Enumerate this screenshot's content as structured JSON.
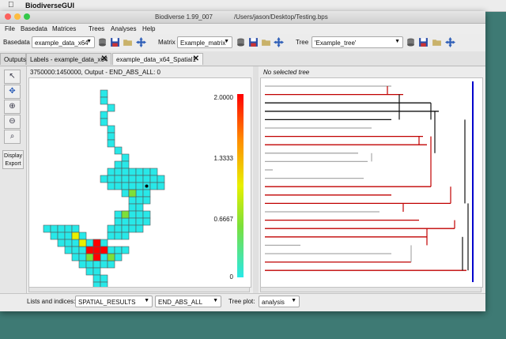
{
  "os_menubar": {
    "apple_glyph": "",
    "app_name": "BiodiverseGUI"
  },
  "window": {
    "title": "Biodiverse 1.99_007",
    "path": "/Users/jason/Desktop/Testing.bps"
  },
  "menu": [
    "File",
    "Basedata",
    "Matrices",
    "Trees",
    "Analyses",
    "Help"
  ],
  "toolbar": {
    "basedata_label": "Basedata",
    "basedata_value": "example_data_x64",
    "matrix_label": "Matrix",
    "matrix_value": "Example_matrix",
    "tree_label": "Tree",
    "tree_value": "'Example_tree'"
  },
  "tabs": [
    {
      "label": "Outputs",
      "closable": false,
      "active": false
    },
    {
      "label": "Labels - example_data_x64",
      "closable": true,
      "active": false
    },
    {
      "label": "example_data_x64_Spatial1",
      "closable": true,
      "active": true
    }
  ],
  "tools": {
    "select": "select-arrow-icon",
    "pan": "pan-arrows-icon",
    "zoom_in": "zoom-in-icon",
    "zoom_out": "zoom-out-icon",
    "zoom_fit": "zoom-fit-icon",
    "display_label": "Display",
    "export_label": "Export"
  },
  "map": {
    "info": "3750000:1450000, Output - END_ABS_ALL: 0",
    "colorbar_ticks": [
      "2.0000",
      "1.3333",
      "0.6667",
      "0"
    ],
    "colors": {
      "low": "#28e8e8",
      "mid": "#e8f000",
      "high": "#ff0000"
    }
  },
  "tree": {
    "title": "No selected tree",
    "colors": {
      "highlight": "#c00000",
      "default": "#aaaaaa",
      "axis": "#0000cc"
    }
  },
  "bottom": {
    "lists_label": "Lists and indices:",
    "list_value": "SPATIAL_RESULTS",
    "index_value": "END_ABS_ALL",
    "treeplot_label": "Tree plot:",
    "treeplot_value": "analysis"
  }
}
